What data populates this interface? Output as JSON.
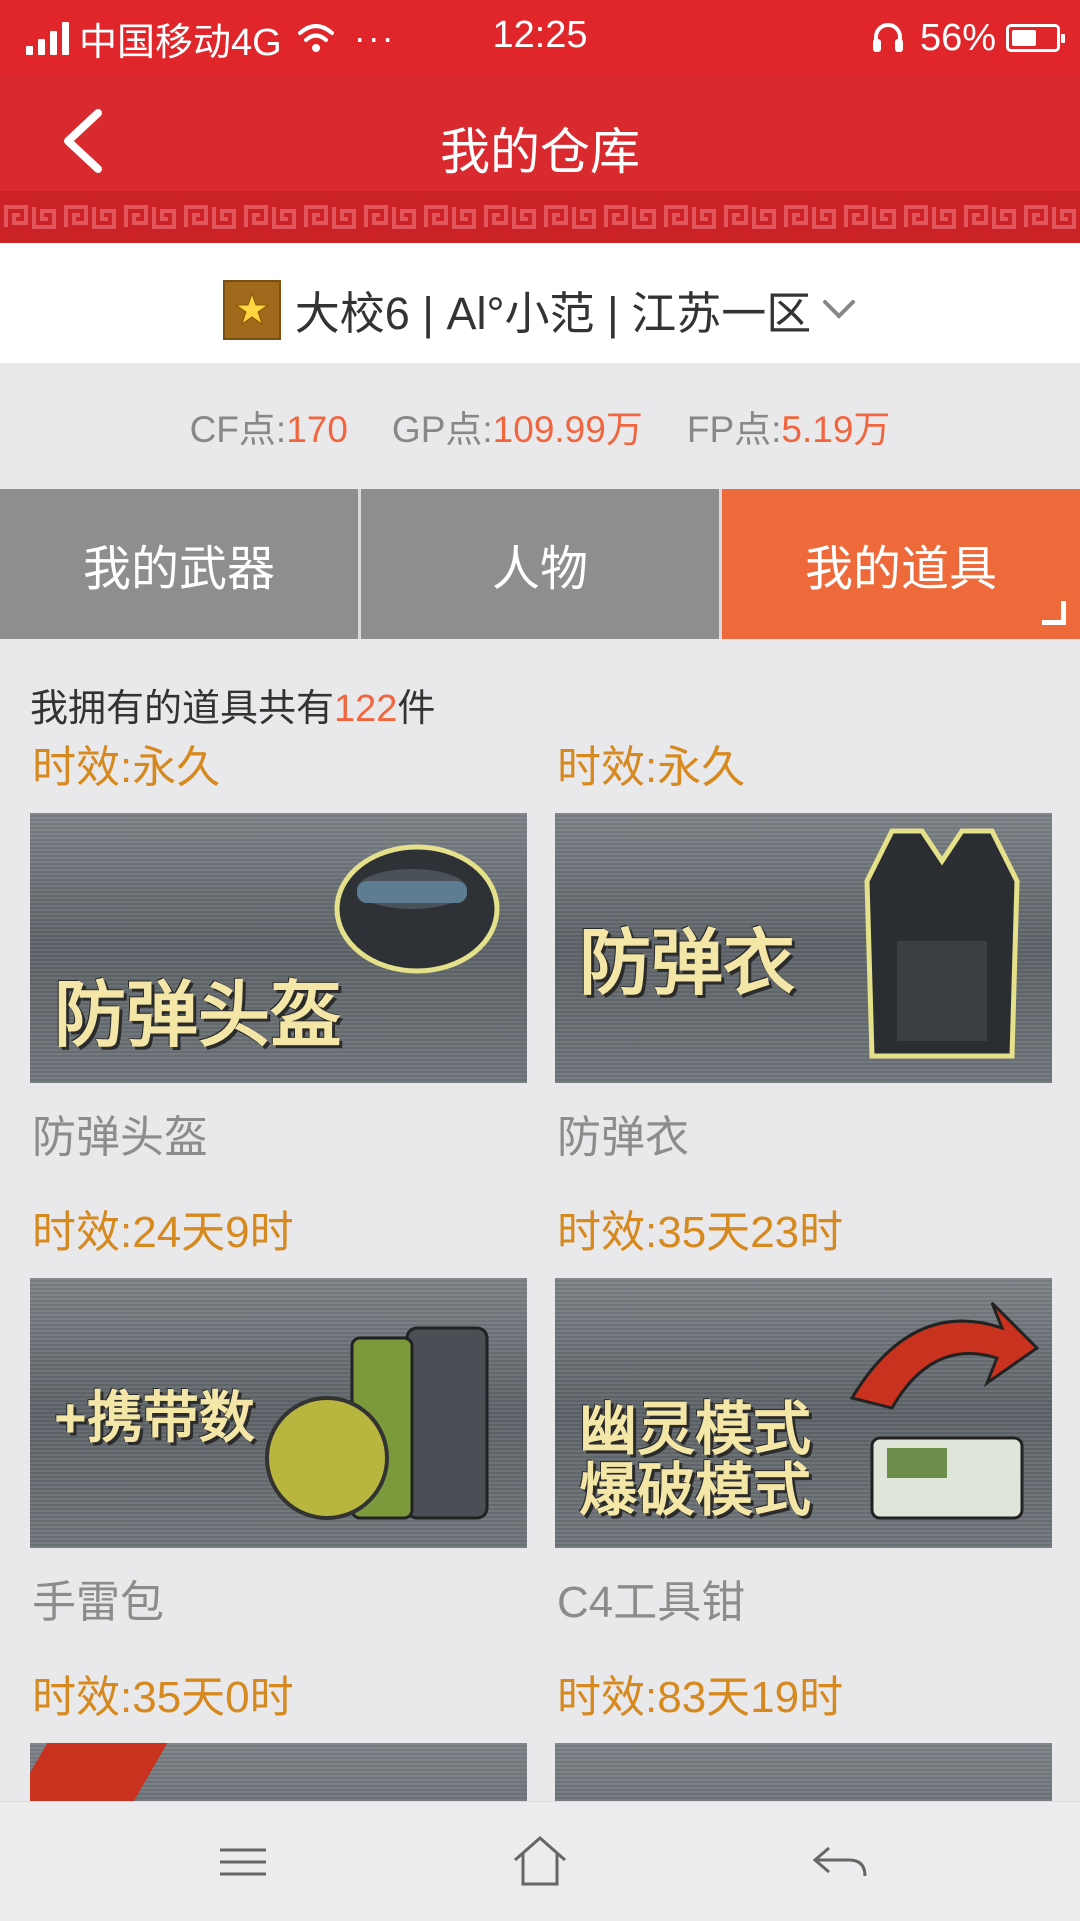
{
  "status_bar": {
    "carrier": "中国移动4G",
    "more": "···",
    "time": "12:25",
    "battery_percent": "56%",
    "battery_level": 0.56,
    "icons": [
      "signal-icon",
      "wifi-icon",
      "headset-icon",
      "battery-icon"
    ]
  },
  "header": {
    "title": "我的仓库",
    "back_icon": "back-arrow-icon"
  },
  "account": {
    "label": "大校6 | Al°小范 | 江苏一区",
    "rank_icon": "rank-badge-icon",
    "dropdown_icon": "chevron-down-icon"
  },
  "points": {
    "cf_label": "CF点:",
    "cf_value": "170",
    "gp_label": "GP点:",
    "gp_value": "109.99万",
    "fp_label": "FP点:",
    "fp_value": "5.19万"
  },
  "tabs": [
    {
      "label": "我的武器",
      "active": false
    },
    {
      "label": "人物",
      "active": false
    },
    {
      "label": "我的道具",
      "active": true
    }
  ],
  "summary": {
    "prefix": "我拥有的道具共有",
    "count": "122",
    "suffix": "件"
  },
  "items": [
    {
      "expiry": "时效:永久",
      "image_text": "防弹头盔",
      "name": "防弹头盔"
    },
    {
      "expiry": "时效:永久",
      "image_text": "防弹衣",
      "name": "防弹衣"
    },
    {
      "expiry": "时效:24天9时",
      "image_text": "+携带数",
      "name": "手雷包"
    },
    {
      "expiry": "时效:35天23时",
      "image_text": "幽灵模式\n爆破模式",
      "name": "C4工具钳"
    },
    {
      "expiry": "时效:35天0时",
      "image_text": "",
      "name": ""
    },
    {
      "expiry": "时效:83天19时",
      "image_text": "",
      "name": ""
    }
  ],
  "colors": {
    "header_red": "#d92a30",
    "status_red": "#e0262b",
    "accent_orange": "#ee6a3b",
    "expiry_gold": "#d6891e",
    "tab_gray": "#8e8e8e"
  },
  "nav_bar": {
    "icons": [
      "menu-icon",
      "home-icon",
      "back-icon"
    ]
  }
}
